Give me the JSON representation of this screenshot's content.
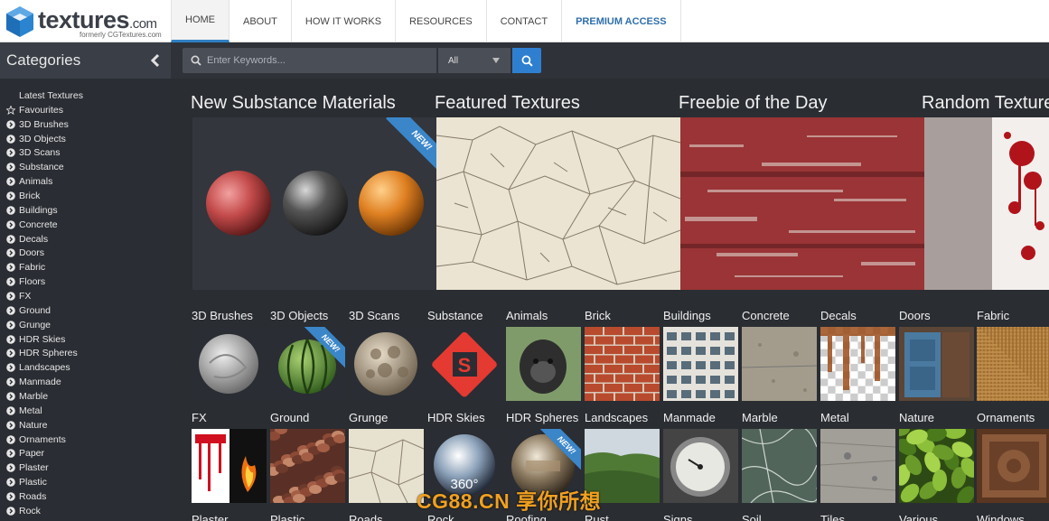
{
  "site": {
    "logo_name": "textures",
    "logo_suffix": ".com",
    "logo_sub": "formerly CGTextures.com"
  },
  "nav": {
    "items": [
      "HOME",
      "ABOUT",
      "HOW IT WORKS",
      "RESOURCES",
      "CONTACT",
      "PREMIUM ACCESS"
    ],
    "active": "HOME"
  },
  "sidebar": {
    "title": "Categories",
    "items": [
      "Latest Textures",
      "Favourites",
      "3D Brushes",
      "3D Objects",
      "3D Scans",
      "Substance",
      "Animals",
      "Brick",
      "Buildings",
      "Concrete",
      "Decals",
      "Doors",
      "Fabric",
      "Floors",
      "FX",
      "Ground",
      "Grunge",
      "HDR Skies",
      "HDR Spheres",
      "Landscapes",
      "Manmade",
      "Marble",
      "Metal",
      "Nature",
      "Ornaments",
      "Paper",
      "Plaster",
      "Plastic",
      "Roads",
      "Rock"
    ]
  },
  "search": {
    "placeholder": "Enter Keywords...",
    "selected": "All"
  },
  "features": {
    "titles": [
      "New Substance Materials",
      "Featured Textures",
      "Freebie of the Day",
      "Random Texture"
    ],
    "new_badge": "NEW!"
  },
  "grid": {
    "row1": [
      "3D Brushes",
      "3D Objects",
      "3D Scans",
      "Substance",
      "Animals",
      "Brick",
      "Buildings",
      "Concrete",
      "Decals",
      "Doors",
      "Fabric"
    ],
    "row2": [
      "FX",
      "Ground",
      "Grunge",
      "HDR Skies",
      "HDR Spheres",
      "Landscapes",
      "Manmade",
      "Marble",
      "Metal",
      "Nature",
      "Ornaments"
    ],
    "row3": [
      "Plaster",
      "Plastic",
      "Roads",
      "Rock",
      "Roofing",
      "Rust",
      "Signs",
      "Soil",
      "Tiles",
      "Various",
      "Windows"
    ],
    "hdr_label": "360°",
    "new_badge": "NEW!"
  },
  "watermark": "CG88.CN 享你所想",
  "colors": {
    "accent": "#2f7fd1",
    "ribbon": "#3b86c9",
    "sidebar_bg": "#2a2d33",
    "main_bg": "#2a2d32"
  }
}
